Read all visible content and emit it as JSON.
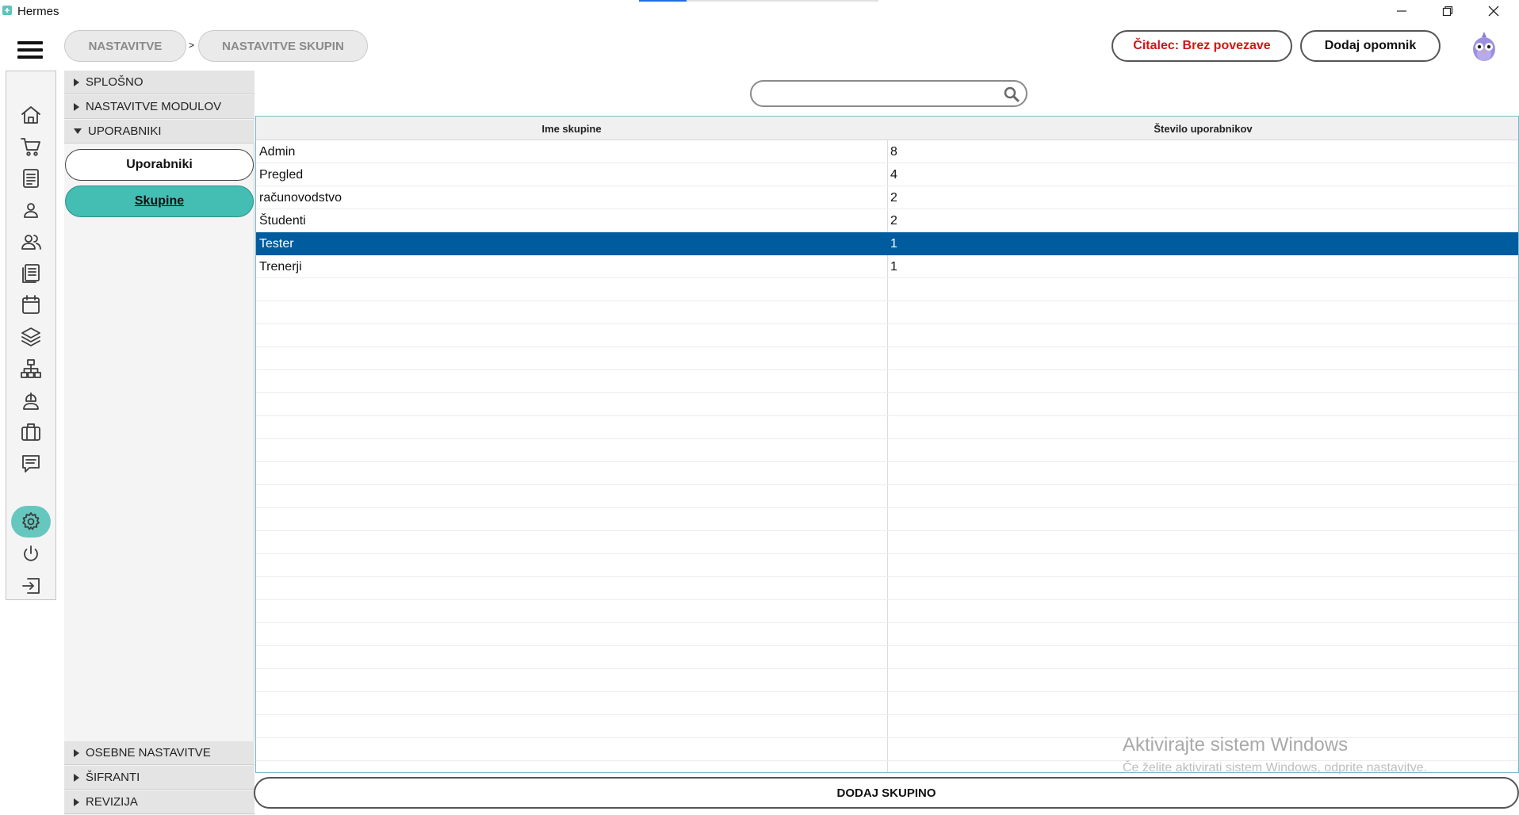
{
  "window": {
    "title": "Hermes",
    "controls": [
      "minimize-icon",
      "restore-icon",
      "close-icon"
    ]
  },
  "header": {
    "breadcrumbs": [
      {
        "label": "NASTAVITVE"
      },
      {
        "label": "NASTAVITVE SKUPIN"
      }
    ],
    "separator": ">",
    "reader_status": "Čitalec: Brez povezave",
    "add_reminder": "Dodaj opomnik",
    "colors": {
      "reader_status": "#d31414"
    }
  },
  "rail": {
    "items": [
      "home-icon",
      "cart-icon",
      "document-icon",
      "user-icon",
      "users-icon",
      "notes-icon",
      "calendar-icon",
      "layers-icon",
      "network-icon",
      "mouse-icon",
      "briefcase-icon",
      "message-icon",
      "settings-icon",
      "power-icon",
      "logout-icon"
    ],
    "active": "settings-icon",
    "accent": "#66c7bf"
  },
  "tree": {
    "sections": [
      {
        "label": "SPLOŠNO",
        "expanded": false
      },
      {
        "label": "NASTAVITVE MODULOV",
        "expanded": false
      },
      {
        "label": "UPORABNIKI",
        "expanded": true
      }
    ],
    "sub_items": [
      {
        "label": "Uporabniki",
        "active": false
      },
      {
        "label": "Skupine",
        "active": true
      }
    ],
    "bottom_sections": [
      {
        "label": "OSEBNE NASTAVITVE"
      },
      {
        "label": "ŠIFRANTI"
      },
      {
        "label": "REVIZIJA"
      }
    ],
    "accent": "#44bdb3"
  },
  "search": {
    "value": "",
    "placeholder": ""
  },
  "table": {
    "columns": [
      "Ime skupine",
      "Število uporabnikov"
    ],
    "rows": [
      {
        "name": "Admin",
        "count": "8"
      },
      {
        "name": "Pregled",
        "count": "4"
      },
      {
        "name": "računovodstvo",
        "count": "2"
      },
      {
        "name": "Študenti",
        "count": "2"
      },
      {
        "name": "Tester",
        "count": "1",
        "selected": true
      },
      {
        "name": "Trenerji",
        "count": "1"
      }
    ],
    "selection_color": "#005c9e"
  },
  "footer": {
    "add_group": "DODAJ SKUPINO"
  },
  "watermark": {
    "line1": "Aktivirajte sistem Windows",
    "line2": "Če želite aktivirati sistem Windows, odprite nastavitve."
  }
}
